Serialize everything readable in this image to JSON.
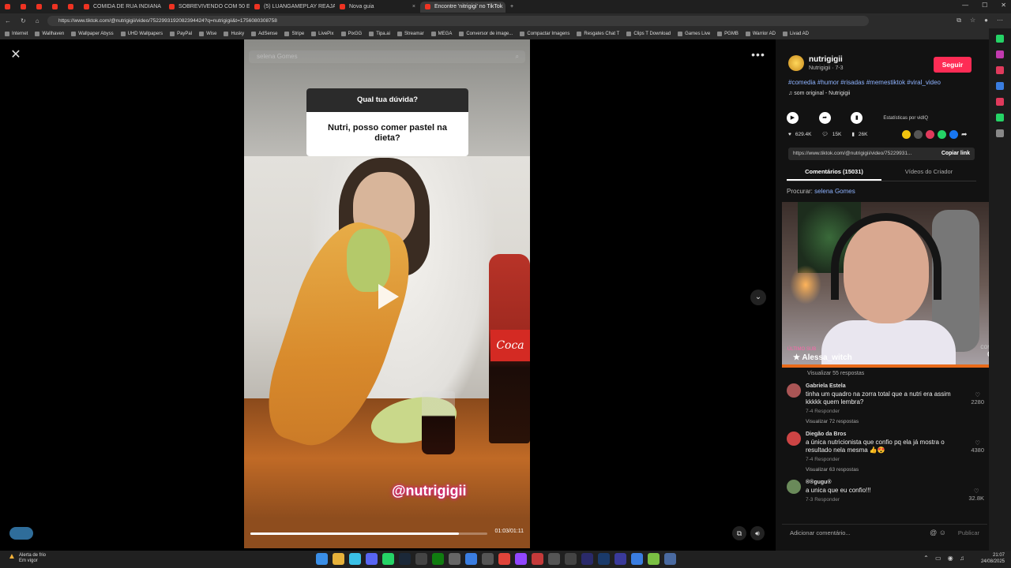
{
  "browser": {
    "tabs": [
      {
        "label": "",
        "kind": "small"
      },
      {
        "label": "",
        "kind": "small"
      },
      {
        "label": "",
        "kind": "small"
      },
      {
        "label": "",
        "kind": "small"
      },
      {
        "label": "",
        "kind": "small"
      },
      {
        "label": "COMIDA DE RUA INDIANA",
        "kind": "wide"
      },
      {
        "label": "SOBREVIVENDO COM 50 EUROS",
        "kind": "wide"
      },
      {
        "label": "(5) LUANGAMEPLAY REAJANDO",
        "kind": "wide"
      },
      {
        "label": "Nova guia",
        "kind": "wide"
      },
      {
        "label": "Encontre 'nitrigigi' no TikTok",
        "kind": "wide"
      }
    ],
    "url": "https://www.tiktok.com/@nutrigigii/video/7522993192082394424?q=nutrigigii&t=1756080308758",
    "bookmarks": [
      "Internet",
      "Wallhaven",
      "Wallpaper Abyss",
      "UHD Wallpapers",
      "PayPal",
      "Wise",
      "Husky",
      "AdSense",
      "Stripe",
      "LivePix",
      "PixGG",
      "Tipa.ai",
      "Streamar",
      "MEGA",
      "Conversor de image...",
      "Compactar Imagens",
      "Resgates Chat T",
      "Clips T Download",
      "Games Live",
      "PGMB",
      "Warrior AD",
      "Livad AD"
    ]
  },
  "video": {
    "search_text": "selena Gomes",
    "question_header": "Qual tua dúvida?",
    "question_body": "Nutri, posso comer pastel na dieta?",
    "bottle_label": "Coca",
    "handle": "@nutrigigii",
    "time": "01:03/01:11",
    "progress": 0.88
  },
  "author": {
    "name": "nutrigigii",
    "sub": "Nutrigigii · 7-3",
    "follow": "Seguir",
    "tags": "#comedia #humor #risadas #memestiktok #viral_video",
    "sound": "som original - Nutrigigii",
    "stats_label": "Estatísticas por vidIQ",
    "likes": "629.4K",
    "comments": "15K",
    "saves": "26K",
    "link": "https://www.tiktok.com/@nutrigigii/video/75229931...",
    "copy_link": "Copiar link",
    "tab_comments": "Comentários (15031)",
    "tab_creator": "Vídeos do Criador",
    "search_prefix": "Procurar:",
    "search_term": "selena Gomes"
  },
  "stream": {
    "label": "ÚLTIMO SUB",
    "user": "Alessa_witch",
    "combo_label": "COMBO",
    "combo_value": "0"
  },
  "comments": {
    "top_replies": "Visualizar 55 respostas",
    "items": [
      {
        "name": "Gabriela Estela",
        "text": "tinha um quadro na zorra total que a nutri era assim kkkkk quem lembra?",
        "meta": "7-4   Responder",
        "likes": "2280",
        "replies": "Visualizar 72 respostas",
        "color": "#a55"
      },
      {
        "name": "Diegão da Bros",
        "text": "a única nutricionista que confio pq ela já mostra o resultado nela mesma 👍😍",
        "meta": "7-4   Responder",
        "likes": "4380",
        "replies": "Visualizar 63 respostas",
        "color": "#c44"
      },
      {
        "name": "®®gugu®",
        "text": "a unica que eu confio!!!",
        "meta": "7-3   Responder",
        "likes": "32.8K",
        "replies": "",
        "color": "#6a8a5a"
      }
    ],
    "add_placeholder": "Adicionar comentário...",
    "publish": "Publicar"
  },
  "taskbar": {
    "weather_title": "Alerta de frio",
    "weather_sub": "Em vigor",
    "time": "21:07",
    "date": "24/08/2025"
  }
}
